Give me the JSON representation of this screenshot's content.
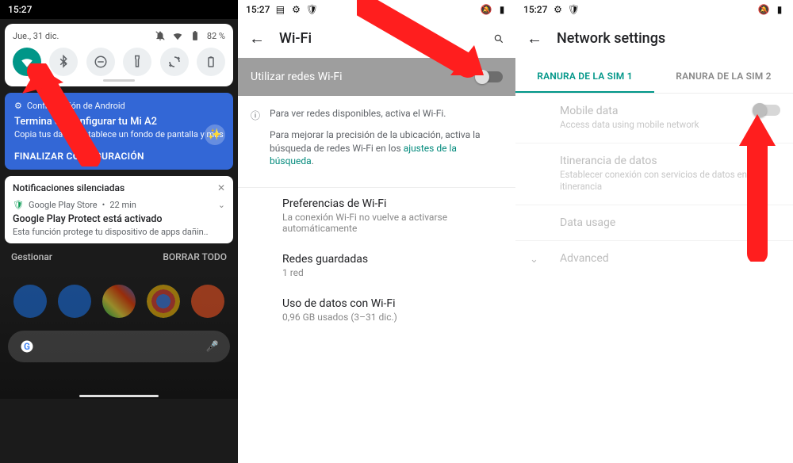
{
  "p1": {
    "time": "15:27",
    "shade": {
      "date": "Jue., 31 dic.",
      "battery": "82 %"
    },
    "qs": [
      "wifi",
      "bluetooth",
      "dnd",
      "flashlight",
      "autorotate",
      "battery"
    ],
    "notif": {
      "app": "Configuración de Android",
      "title": "Termina de configurar tu Mi A2",
      "sub": "Copia tus datos, establece un fondo de pantalla y más",
      "action": "FINALIZAR CONFIGURACIÓN"
    },
    "silenced": {
      "header": "Notificaciones silenciadas",
      "meta_app": "Google Play Store",
      "meta_time": "22 min",
      "title": "Google Play Protect está activado",
      "sub": "Esta función protege tu dispositivo de apps dañin.."
    },
    "footer": {
      "manage": "Gestionar",
      "clear": "BORRAR TODO"
    }
  },
  "p2": {
    "time": "15:27",
    "title": "Wi-Fi",
    "toggle_label": "Utilizar redes Wi-Fi",
    "info_p1": "Para ver redes disponibles, activa el Wi-Fi.",
    "info_p2a": "Para mejorar la precisión de la ubicación, activa la búsqueda de redes Wi-Fi en los ",
    "info_link": "ajustes de la búsqueda",
    "items": [
      {
        "t": "Preferencias de Wi-Fi",
        "s": "La conexión Wi-Fi no vuelve a activarse automáticamente"
      },
      {
        "t": "Redes guardadas",
        "s": "1 red"
      },
      {
        "t": "Uso de datos con Wi-Fi",
        "s": "0,96 GB usados (3–31 dic.)"
      }
    ]
  },
  "p3": {
    "time": "15:27",
    "title": "Network settings",
    "tabs": [
      "RANURA DE LA SIM 1",
      "RANURA DE LA SIM 2"
    ],
    "rows": [
      {
        "t": "Mobile data",
        "s": "Access data using mobile network",
        "switch": true
      },
      {
        "t": "Itinerancia de datos",
        "s": "Establecer conexión con servicios de datos en itinerancia",
        "switch": false
      },
      {
        "t": "Data usage",
        "s": "",
        "switch": false
      },
      {
        "t": "Advanced",
        "s": "",
        "switch": false,
        "chev": true
      }
    ]
  }
}
